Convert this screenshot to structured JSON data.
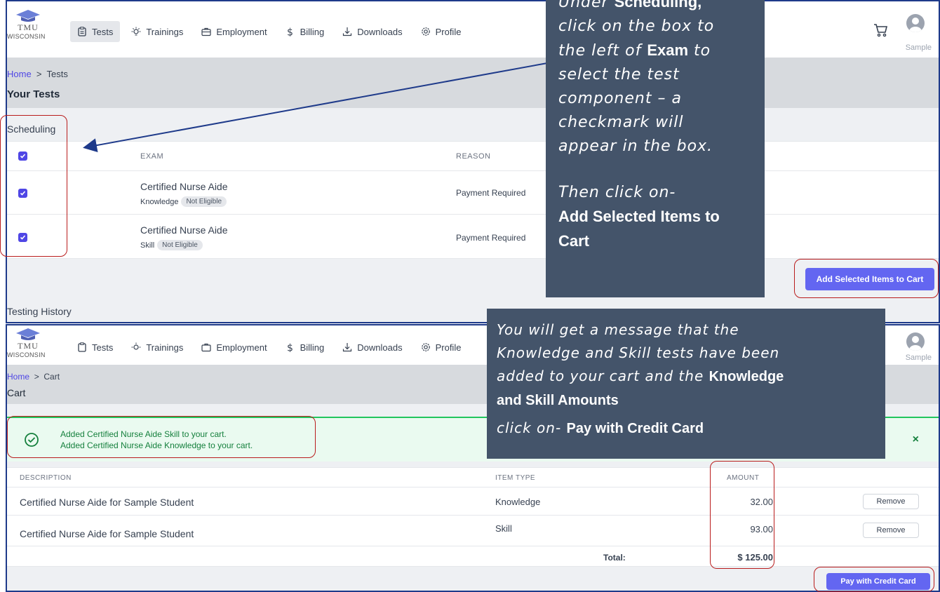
{
  "nav": {
    "logo_top": "TMU",
    "logo_bottom": "WISCONSIN",
    "items": [
      {
        "label": "Tests",
        "icon": "clipboard-icon"
      },
      {
        "label": "Trainings",
        "icon": "lightbulb-icon"
      },
      {
        "label": "Employment",
        "icon": "briefcase-icon"
      },
      {
        "label": "Billing",
        "icon": "dollar-icon"
      },
      {
        "label": "Downloads",
        "icon": "download-icon"
      },
      {
        "label": "Profile",
        "icon": "gear-icon"
      }
    ],
    "user_name": "Sample"
  },
  "tests_screen": {
    "breadcrumb_home": "Home",
    "breadcrumb_sep": ">",
    "breadcrumb_current": "Tests",
    "heading": "Your Tests",
    "section_title": "Scheduling",
    "columns": {
      "exam": "EXAM",
      "reason": "REASON"
    },
    "rows": [
      {
        "name": "Certified Nurse Aide",
        "type": "Knowledge",
        "badge": "Not Eligible",
        "reason": "Payment Required"
      },
      {
        "name": "Certified Nurse Aide",
        "type": "Skill",
        "badge": "Not Eligible",
        "reason": "Payment Required"
      }
    ],
    "add_button": "Add Selected Items to Cart",
    "history_title": "Testing History"
  },
  "cart_screen": {
    "breadcrumb_home": "Home",
    "breadcrumb_sep": ">",
    "breadcrumb_current": "Cart",
    "heading": "Cart",
    "alert_lines": [
      "Added Certified Nurse Aide Skill to your cart.",
      "Added Certified Nurse Aide Knowledge to your cart."
    ],
    "alert_close": "×",
    "columns": {
      "description": "DESCRIPTION",
      "item_type": "ITEM TYPE",
      "amount": "AMOUNT"
    },
    "rows": [
      {
        "description": "Certified Nurse Aide for Sample Student",
        "item_type": "Knowledge",
        "amount": "32.00",
        "remove": "Remove"
      },
      {
        "description": "Certified Nurse Aide for Sample Student",
        "item_type": "Skill",
        "amount": "93.00",
        "remove": "Remove"
      }
    ],
    "total_label": "Total:",
    "total_value": "$ 125.00",
    "pay_button": "Pay with Credit Card"
  },
  "callouts": {
    "first": {
      "l1a": "Under ",
      "l1b": "Scheduling,",
      "l2": "click on the box to",
      "l3a": "the left of ",
      "l3b": "Exam",
      "l3c": " to",
      "l4": "select the test",
      "l5": "component – a",
      "l6": "checkmark will",
      "l7": "appear in the box.",
      "l8": "Then click on-",
      "l9": "Add Selected Items to",
      "l10": "Cart"
    },
    "second": {
      "l1": "You will get a message that the",
      "l2": "Knowledge and Skill tests have been",
      "l3a": "added to your cart and the ",
      "l3b": "Knowledge",
      "l4": "and Skill Amounts",
      "l5a": "click on- ",
      "l5b": "Pay with Credit Card"
    }
  },
  "colors": {
    "accent": "#6366f1",
    "callout": "#44546a",
    "success": "#22c55e",
    "annotation": "#b91c1c",
    "frame": "#1e3a8a"
  }
}
